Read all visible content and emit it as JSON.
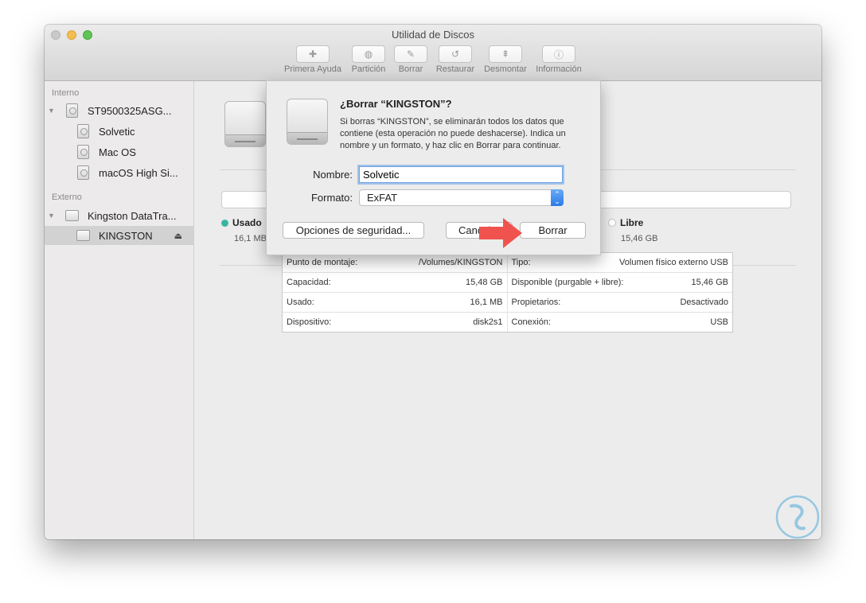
{
  "window": {
    "title": "Utilidad de Discos"
  },
  "toolbar": {
    "items": [
      {
        "label": "Primera Ayuda",
        "icon": "first-aid-icon",
        "glyph": "✚"
      },
      {
        "label": "Partición",
        "icon": "partition-icon",
        "glyph": "◍"
      },
      {
        "label": "Borrar",
        "icon": "erase-icon",
        "glyph": "✎"
      },
      {
        "label": "Restaurar",
        "icon": "restore-icon",
        "glyph": "↺"
      },
      {
        "label": "Desmontar",
        "icon": "unmount-icon",
        "glyph": "⇞"
      },
      {
        "label": "Información",
        "icon": "info-icon",
        "glyph": "ⓘ"
      }
    ]
  },
  "sidebar": {
    "internal_header": "Interno",
    "external_header": "Externo",
    "internal_disk": "ST9500325ASG...",
    "internal_volumes": [
      "Solvetic",
      "Mac OS",
      "macOS High Si..."
    ],
    "external_disk": "Kingston DataTra...",
    "external_volume": "KINGSTON"
  },
  "usage": {
    "used_label": "Usado",
    "used_value": "16,1 MB",
    "used_color": "#3bb5a0",
    "free_label": "Libre",
    "free_value": "15,46 GB",
    "free_color": "#ffffff"
  },
  "info": {
    "rows": [
      [
        {
          "k": "Punto de montaje:",
          "v": "/Volumes/KINGSTON"
        },
        {
          "k": "Tipo:",
          "v": "Volumen físico externo USB"
        }
      ],
      [
        {
          "k": "Capacidad:",
          "v": "15,48 GB"
        },
        {
          "k": "Disponible (purgable + libre):",
          "v": "15,46 GB"
        }
      ],
      [
        {
          "k": "Usado:",
          "v": "16,1 MB"
        },
        {
          "k": "Propietarios:",
          "v": "Desactivado"
        }
      ],
      [
        {
          "k": "Dispositivo:",
          "v": "disk2s1"
        },
        {
          "k": "Conexión:",
          "v": "USB"
        }
      ]
    ]
  },
  "dialog": {
    "title": "¿Borrar “KINGSTON”?",
    "message": "Si borras “KINGSTON”, se eliminarán todos los datos que contiene (esta operación no puede deshacerse). Indica un nombre y un formato, y haz clic en Borrar para continuar.",
    "name_label": "Nombre:",
    "name_value": "Solvetic",
    "format_label": "Formato:",
    "format_value": "ExFAT",
    "security_button": "Opciones de seguridad...",
    "cancel_button": "Cancelar",
    "erase_button": "Borrar"
  },
  "annotation": {
    "arrow_color": "#f0534e"
  },
  "watermark": {
    "color": "#2e9bd6"
  }
}
